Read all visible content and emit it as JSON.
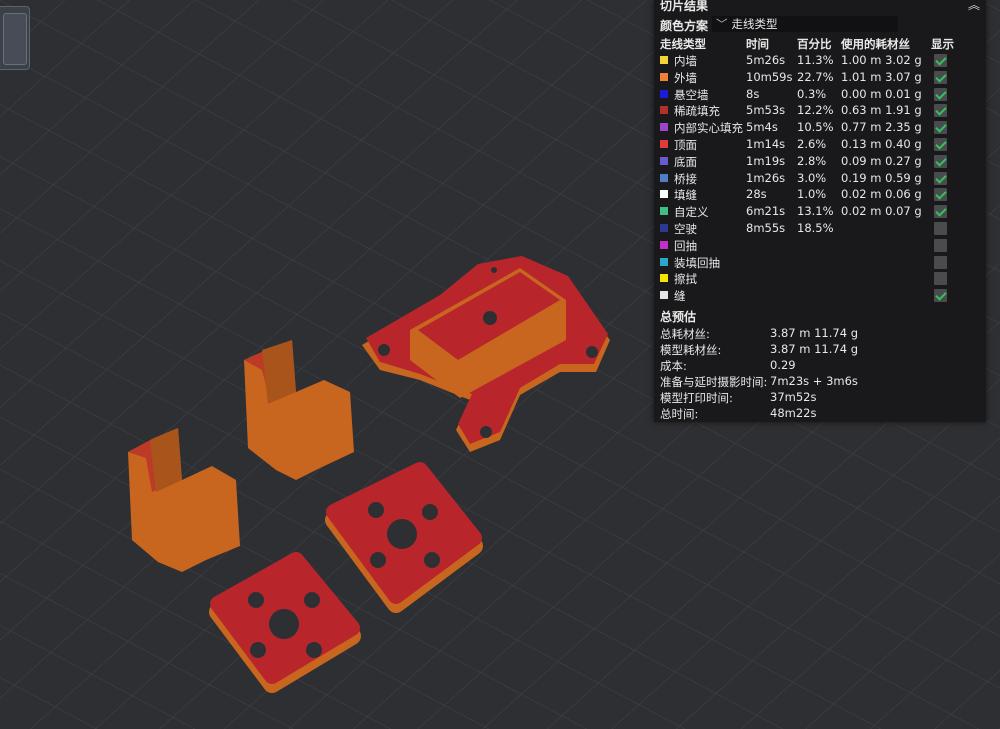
{
  "panel": {
    "title": "切片结果",
    "color_scheme_label": "颜色方案",
    "color_scheme_value": "走线类型",
    "columns": {
      "type": "走线类型",
      "time": "时间",
      "percent": "百分比",
      "used": "使用的耗材丝",
      "show": "显示"
    },
    "rows": [
      {
        "name": "内墙",
        "color": "#f5d33a",
        "time": "5m26s",
        "percent": "11.3%",
        "used": "1.00 m  3.02 g",
        "show": true
      },
      {
        "name": "外墙",
        "color": "#f07f3a",
        "time": "10m59s",
        "percent": "22.7%",
        "used": "1.01 m  3.07 g",
        "show": true
      },
      {
        "name": "悬空墙",
        "color": "#1b1bd9",
        "time": "8s",
        "percent": "0.3%",
        "used": "0.00 m  0.01 g",
        "show": true
      },
      {
        "name": "稀疏填充",
        "color": "#b0302a",
        "time": "5m53s",
        "percent": "12.2%",
        "used": "0.63 m  1.91 g",
        "show": true
      },
      {
        "name": "内部实心填充",
        "color": "#9b45c9",
        "time": "5m4s",
        "percent": "10.5%",
        "used": "0.77 m  2.35 g",
        "show": true
      },
      {
        "name": "顶面",
        "color": "#e03a3a",
        "time": "1m14s",
        "percent": "2.6%",
        "used": "0.13 m  0.40 g",
        "show": true
      },
      {
        "name": "底面",
        "color": "#6a5acd",
        "time": "1m19s",
        "percent": "2.8%",
        "used": "0.09 m  0.27 g",
        "show": true
      },
      {
        "name": "桥接",
        "color": "#4f7fc2",
        "time": "1m26s",
        "percent": "3.0%",
        "used": "0.19 m  0.59 g",
        "show": true
      },
      {
        "name": "填缝",
        "color": "#ffffff",
        "time": "28s",
        "percent": "1.0%",
        "used": "0.02 m  0.06 g",
        "show": true
      },
      {
        "name": "自定义",
        "color": "#3fbf83",
        "time": "6m21s",
        "percent": "13.1%",
        "used": "0.02 m  0.07 g",
        "show": true
      },
      {
        "name": "空驶",
        "color": "#2b3a8f",
        "time": "8m55s",
        "percent": "18.5%",
        "used": "",
        "show": false
      },
      {
        "name": "回抽",
        "color": "#c22fc9",
        "time": "",
        "percent": "",
        "used": "",
        "show": false
      },
      {
        "name": "装填回抽",
        "color": "#2aa7c9",
        "time": "",
        "percent": "",
        "used": "",
        "show": false
      },
      {
        "name": "擦拭",
        "color": "#f2e600",
        "time": "",
        "percent": "",
        "used": "",
        "show": false
      },
      {
        "name": "缝",
        "color": "#e6e6e6",
        "time": "",
        "percent": "",
        "used": "",
        "show": true
      }
    ],
    "summary_title": "总预估",
    "summary": [
      {
        "key": "总耗材丝:",
        "value": "3.87 m    11.74 g"
      },
      {
        "key": "模型耗材丝:",
        "value": "3.87 m    11.74 g"
      },
      {
        "key": "成本:",
        "value": "0.29"
      },
      {
        "key": "准备与延时摄影时间:",
        "value": "7m23s + 3m6s"
      },
      {
        "key": "模型打印时间:",
        "value": "37m52s"
      },
      {
        "key": "总时间:",
        "value": "48m22s"
      }
    ]
  },
  "colors": {
    "part_orange": "#c8661f",
    "part_red": "#b8262c",
    "background": "#2e2f33"
  }
}
